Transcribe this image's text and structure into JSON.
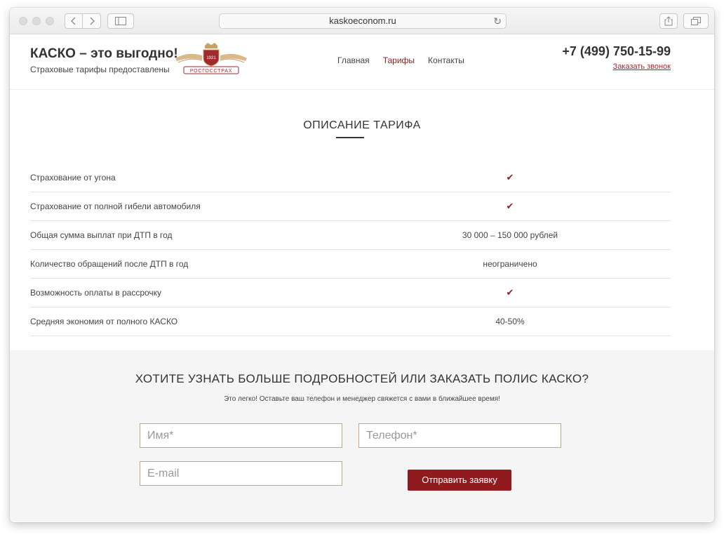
{
  "browser": {
    "url": "kaskoeconom.ru",
    "back_icon": "chevron-left-icon",
    "forward_icon": "chevron-right-icon"
  },
  "header": {
    "title": "КАСКО – это выгодно!",
    "subtitle": "Страховые тарифы предоставлены",
    "logo_text": "РОСГОССТРАХ",
    "logo_year": "1921",
    "nav": [
      {
        "label": "Главная",
        "active": false
      },
      {
        "label": "Тарифы",
        "active": true
      },
      {
        "label": "Контакты",
        "active": false
      }
    ],
    "phone": "+7 (499) 750-15-99",
    "callback_label": "Заказать звонок"
  },
  "tariff": {
    "title": "ОПИСАНИЕ ТАРИФА",
    "rows": [
      {
        "label": "Страхование от угона",
        "value": "✔"
      },
      {
        "label": "Страхование от полной гибели автомобиля",
        "value": "✔"
      },
      {
        "label": "Общая сумма выплат при ДТП в год",
        "value": "30 000 – 150 000 рублей"
      },
      {
        "label": "Количество обращений после ДТП в год",
        "value": "неограничено"
      },
      {
        "label": "Возможность оплаты в рассрочку",
        "value": "✔"
      },
      {
        "label": "Средняя экономия от полного КАСКО",
        "value": "40-50%"
      }
    ]
  },
  "form": {
    "title": "ХОТИТЕ УЗНАТЬ БОЛЬШЕ ПОДРОБНОСТЕЙ ИЛИ ЗАКАЗАТЬ ПОЛИС КАСКО?",
    "subtitle": "Это легко! Оставьте ваш телефон и менеджер свяжется с вами в ближайшее время!",
    "name_placeholder": "Имя*",
    "phone_placeholder": "Телефон*",
    "email_placeholder": "E-mail",
    "submit_label": "Отправить заявку"
  },
  "colors": {
    "accent": "#8f1b1e",
    "input_border": "#c9a86a"
  }
}
